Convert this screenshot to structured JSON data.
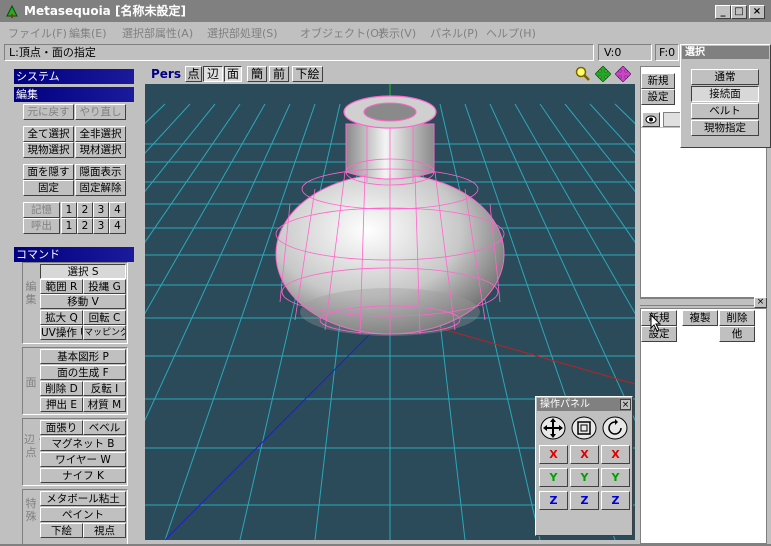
{
  "window": {
    "title": "Metasequoia [名称未設定]",
    "min": "_",
    "max": "□",
    "close": "×"
  },
  "menu": [
    "ファイル(F)",
    "編集(E)",
    "選択部属性(A)",
    "選択部処理(S)",
    "オブジェクト(O)",
    "表示(V)",
    "パネル(P)",
    "ヘルプ(H)"
  ],
  "status": {
    "mode": "L:頂点・面の指定",
    "vertex": "V:0",
    "face": "F:0"
  },
  "left": {
    "system": "システム",
    "edit": "編集",
    "undo": "元に戻す",
    "redo": "やり直し",
    "select_all": "全て選択",
    "deselect_all": "全非選択",
    "cur_obj_sel": "現物選択",
    "cur_mat_sel": "現材選択",
    "hide_face": "面を隠す",
    "show_hidden": "隠面表示",
    "fix": "固定",
    "unfix": "固定解除",
    "memory": "記憶",
    "recall": "呼出",
    "slots": [
      "1",
      "2",
      "3",
      "4"
    ],
    "command": "コマンド",
    "group_edit": "編集",
    "group_face": "面",
    "group_edge": "辺・点",
    "group_special": "特殊",
    "cmd_select": "選択 S",
    "cmd_range": "範囲 R",
    "cmd_lasso": "投縄 G",
    "cmd_move": "移動 V",
    "cmd_scale": "拡大 Q",
    "cmd_rotate": "回転 C",
    "cmd_uv": "UV操作 U",
    "cmd_mapping": "マッピング",
    "cmd_primitive": "基本図形 P",
    "cmd_face_gen": "面の生成 F",
    "cmd_delete": "削除 D",
    "cmd_flip": "反転 I",
    "cmd_extrude": "押出 E",
    "cmd_material": "材質 M",
    "cmd_face_stretch": "面張り",
    "cmd_bevel": "ベベル",
    "cmd_magnet": "マグネット B",
    "cmd_wire": "ワイヤー W",
    "cmd_knife": "ナイフ K",
    "cmd_metaball": "メタボール粘土",
    "cmd_paint": "ペイント",
    "cmd_underlay": "下絵",
    "cmd_viewpoint": "視点"
  },
  "viewport": {
    "mode": "Pers",
    "toggles": [
      "点",
      "辺",
      "面",
      "簡",
      "前",
      "下絵"
    ],
    "active_toggles": [
      "辺",
      "面"
    ]
  },
  "right": {
    "new": "新規",
    "settings": "設定",
    "select_title": "選択",
    "sel_normal": "通常",
    "sel_connected": "接続面",
    "sel_belt": "ベルト",
    "sel_cur_obj": "現物指定",
    "mat_new": "新規",
    "mat_copy": "複製",
    "mat_delete": "削除",
    "mat_settings": "設定",
    "mat_other": "他"
  },
  "op_panel": {
    "title": "操作パネル",
    "axes": [
      "X",
      "Y",
      "Z"
    ]
  },
  "colors": {
    "title_bar": "#808080",
    "section": "#000080",
    "viewport_bg": "#2b4b5b",
    "grid": "#2aa8b8",
    "wire": "#ff66cc"
  }
}
